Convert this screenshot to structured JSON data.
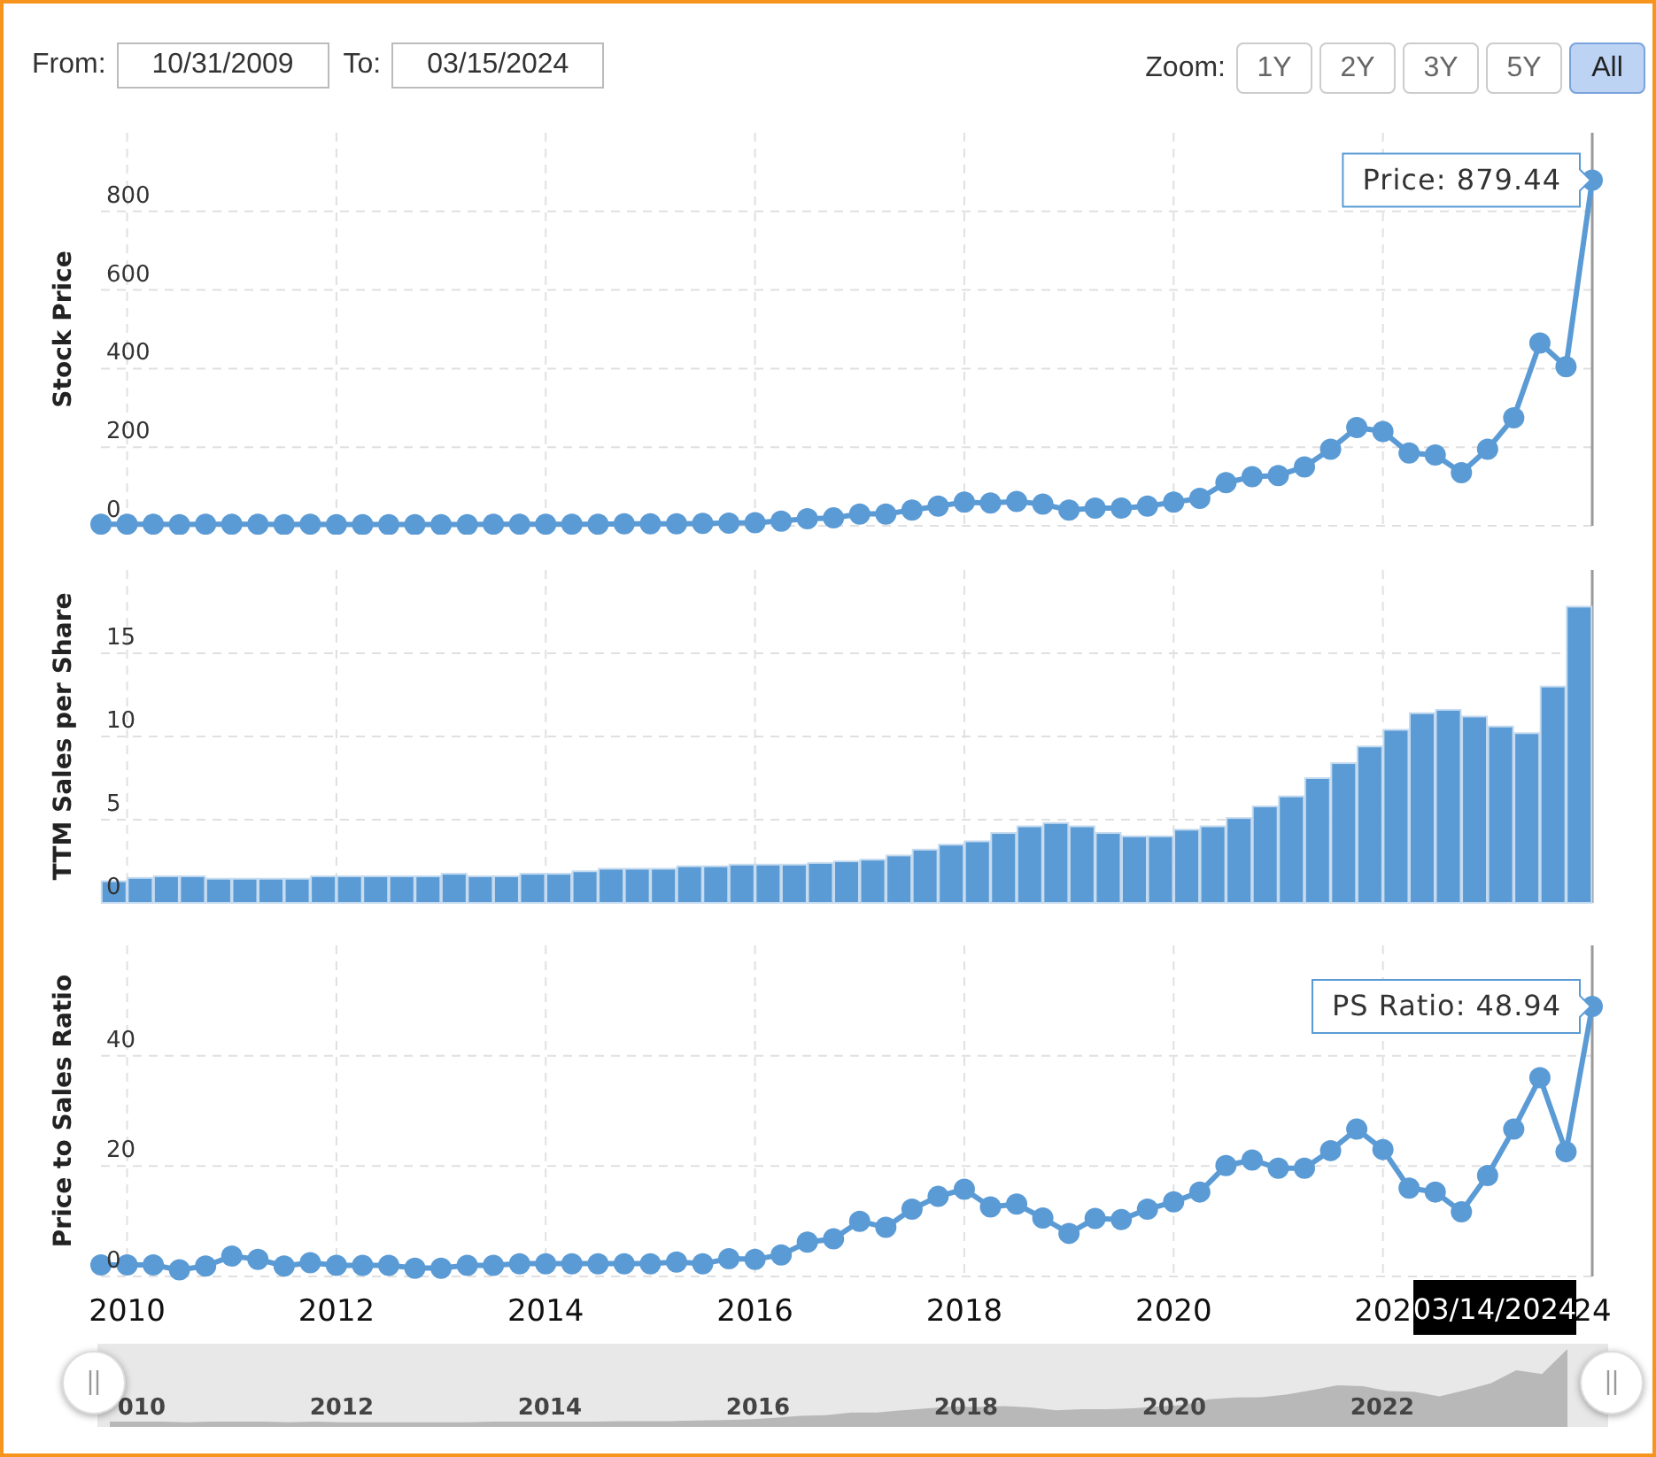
{
  "range": {
    "from": {
      "label": "From:",
      "value": "10/31/2009"
    },
    "to": {
      "label": "To:",
      "value": "03/15/2024"
    }
  },
  "zoom": {
    "label": "Zoom:",
    "buttons": [
      {
        "label": "1Y",
        "selected": false
      },
      {
        "label": "2Y",
        "selected": false
      },
      {
        "label": "3Y",
        "selected": false
      },
      {
        "label": "5Y",
        "selected": false
      },
      {
        "label": "All",
        "selected": true
      }
    ]
  },
  "charts": [
    {
      "tooltip": "Price: 879.44",
      "chart_data": {
        "type": "line",
        "grid": true,
        "ylabel": "Stock Price",
        "xlim": [
          2009.75,
          2024
        ],
        "ylim": [
          0,
          1000
        ],
        "yticks": [
          0,
          200,
          400,
          600,
          800
        ],
        "x": [
          2009.75,
          2010,
          2010.25,
          2010.5,
          2010.75,
          2011,
          2011.25,
          2011.5,
          2011.75,
          2012,
          2012.25,
          2012.5,
          2012.75,
          2013,
          2013.25,
          2013.5,
          2013.75,
          2014,
          2014.25,
          2014.5,
          2014.75,
          2015,
          2015.25,
          2015.5,
          2015.75,
          2016,
          2016.25,
          2016.5,
          2016.75,
          2017,
          2017.25,
          2017.5,
          2017.75,
          2018,
          2018.25,
          2018.5,
          2018.75,
          2019,
          2019.25,
          2019.5,
          2019.75,
          2020,
          2020.25,
          2020.5,
          2020.75,
          2021,
          2021.25,
          2021.5,
          2021.75,
          2022,
          2022.25,
          2022.5,
          2022.75,
          2023,
          2023.25,
          2023.5,
          2023.75,
          2024
        ],
        "series": [
          {
            "color": "#5b9bd5",
            "marker": true,
            "values": [
              4,
              4,
              4,
              3,
              4,
              4,
              4,
              3,
              4,
              3,
              3,
              3,
              3,
              3,
              3,
              4,
              4,
              4,
              4,
              4,
              5,
              5,
              5,
              6,
              7,
              8,
              12,
              18,
              20,
              30,
              30,
              40,
              50,
              60,
              58,
              62,
              55,
              40,
              45,
              45,
              50,
              60,
              70,
              110,
              125,
              128,
              150,
              195,
              250,
              240,
              185,
              180,
              135,
              195,
              275,
              465,
              405,
              879.44
            ]
          }
        ]
      }
    },
    {
      "chart_data": {
        "type": "bar",
        "grid": true,
        "ylabel": "TTM Sales per Share",
        "xlim": [
          2009.75,
          2024
        ],
        "ylim": [
          0,
          20
        ],
        "yticks": [
          0,
          5,
          10,
          15
        ],
        "x": [
          2009.875,
          2010.125,
          2010.375,
          2010.625,
          2010.875,
          2011.125,
          2011.375,
          2011.625,
          2011.875,
          2012.125,
          2012.375,
          2012.625,
          2012.875,
          2013.125,
          2013.375,
          2013.625,
          2013.875,
          2014.125,
          2014.375,
          2014.625,
          2014.875,
          2015.125,
          2015.375,
          2015.625,
          2015.875,
          2016.125,
          2016.375,
          2016.625,
          2016.875,
          2017.125,
          2017.375,
          2017.625,
          2017.875,
          2018.125,
          2018.375,
          2018.625,
          2018.875,
          2019.125,
          2019.375,
          2019.625,
          2019.875,
          2020.125,
          2020.375,
          2020.625,
          2020.875,
          2021.125,
          2021.375,
          2021.625,
          2021.875,
          2022.125,
          2022.375,
          2022.625,
          2022.875,
          2023.125,
          2023.375,
          2023.625,
          2023.875
        ],
        "series": [
          {
            "color": "#5b9bd5",
            "values": [
              1.3,
              1.5,
              1.6,
              1.6,
              1.45,
              1.45,
              1.45,
              1.45,
              1.6,
              1.6,
              1.6,
              1.6,
              1.6,
              1.75,
              1.6,
              1.6,
              1.75,
              1.75,
              1.9,
              2.05,
              2.05,
              2.05,
              2.2,
              2.2,
              2.3,
              2.3,
              2.3,
              2.4,
              2.5,
              2.6,
              2.85,
              3.2,
              3.5,
              3.7,
              4.2,
              4.6,
              4.8,
              4.6,
              4.2,
              4.0,
              4.0,
              4.4,
              4.6,
              5.1,
              5.8,
              6.4,
              7.5,
              8.4,
              9.4,
              10.4,
              11.4,
              11.6,
              11.2,
              10.6,
              10.2,
              13.0,
              17.8
            ]
          }
        ]
      }
    },
    {
      "tooltip": "PS Ratio: 48.94",
      "cut_tick_labels": [
        "202",
        "24"
      ],
      "chart_data": {
        "type": "line",
        "grid": true,
        "ylabel": "Price to Sales Ratio",
        "xlim": [
          2009.75,
          2024
        ],
        "ylim": [
          0,
          60
        ],
        "yticks": [
          0,
          20,
          40
        ],
        "xticks": [
          2010,
          2012,
          2014,
          2016,
          2018,
          2020
        ],
        "x": [
          2009.75,
          2010,
          2010.25,
          2010.5,
          2010.75,
          2011,
          2011.25,
          2011.5,
          2011.75,
          2012,
          2012.25,
          2012.5,
          2012.75,
          2013,
          2013.25,
          2013.5,
          2013.75,
          2014,
          2014.25,
          2014.5,
          2014.75,
          2015,
          2015.25,
          2015.5,
          2015.75,
          2016,
          2016.25,
          2016.5,
          2016.75,
          2017,
          2017.25,
          2017.5,
          2017.75,
          2018,
          2018.25,
          2018.5,
          2018.75,
          2019,
          2019.25,
          2019.5,
          2019.75,
          2020,
          2020.25,
          2020.5,
          2020.75,
          2021,
          2021.25,
          2021.5,
          2021.75,
          2022,
          2022.25,
          2022.5,
          2022.75,
          2023,
          2023.25,
          2023.5,
          2023.75,
          2024
        ],
        "series": [
          {
            "color": "#5b9bd5",
            "marker": true,
            "values": [
              2.1,
              2.1,
              2.1,
              1.2,
              1.9,
              3.7,
              3.1,
              1.9,
              2.5,
              2,
              2,
              2,
              1.5,
              1.5,
              2,
              2,
              2.3,
              2.3,
              2.3,
              2.3,
              2.3,
              2.3,
              2.6,
              2.3,
              3.2,
              3.1,
              3.9,
              6.2,
              6.8,
              10,
              8.9,
              12.2,
              14.5,
              15.8,
              12.6,
              13.1,
              10.6,
              7.8,
              10.5,
              10.3,
              12.2,
              13.5,
              15.3,
              20.1,
              21.1,
              19.6,
              19.6,
              22.8,
              26.7,
              23,
              16,
              15.3,
              11.7,
              18.3,
              26.7,
              36,
              22.6,
              48.94
            ]
          }
        ]
      }
    }
  ],
  "crosshair_label": "03/14/2024",
  "navigator": {
    "labels": [
      "010",
      "2012",
      "2014",
      "2016",
      "2018",
      "2020",
      "2022"
    ]
  }
}
